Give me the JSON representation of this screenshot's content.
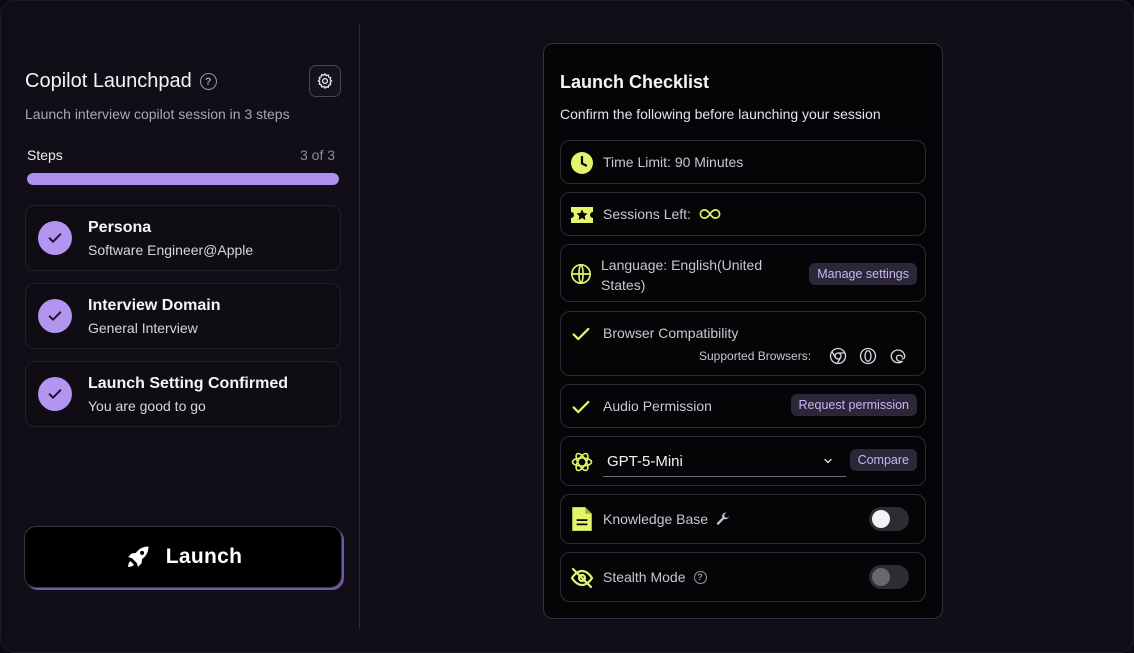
{
  "left_panel": {
    "title": "Copilot Launchpad",
    "help_icon": "?",
    "subtitle": "Launch interview copilot session in 3 steps",
    "steps_label": "Steps",
    "steps_count": "3 of 3",
    "progress_fraction": 1.0,
    "steps": [
      {
        "title": "Persona",
        "subtitle": "Software Engineer@Apple",
        "completed": true
      },
      {
        "title": "Interview Domain",
        "subtitle": "General Interview",
        "completed": true
      },
      {
        "title": "Launch Setting Confirmed",
        "subtitle": "You are good to go",
        "completed": true
      }
    ],
    "launch_label": "Launch"
  },
  "checklist": {
    "title": "Launch Checklist",
    "subtitle": "Confirm the following before launching your session",
    "time_limit": "Time Limit: 90 Minutes",
    "sessions_left": "Sessions Left:",
    "language": "Language: English(United States)",
    "manage_settings": "Manage settings",
    "browser_compat": "Browser Compatibility",
    "supported_browsers": "Supported Browsers:",
    "browsers": [
      "chrome-icon",
      "opera-icon",
      "edge-icon"
    ],
    "audio_permission": "Audio Permission",
    "request_permission": "Request permission",
    "model": "GPT-5-Mini",
    "compare": "Compare",
    "knowledge_base": "Knowledge Base",
    "knowledge_base_enabled": false,
    "stealth_mode": "Stealth Mode",
    "stealth_mode_enabled": false
  },
  "colors": {
    "accent": "#b295f1",
    "highlight": "#e3f56a",
    "background": "#110e17"
  }
}
